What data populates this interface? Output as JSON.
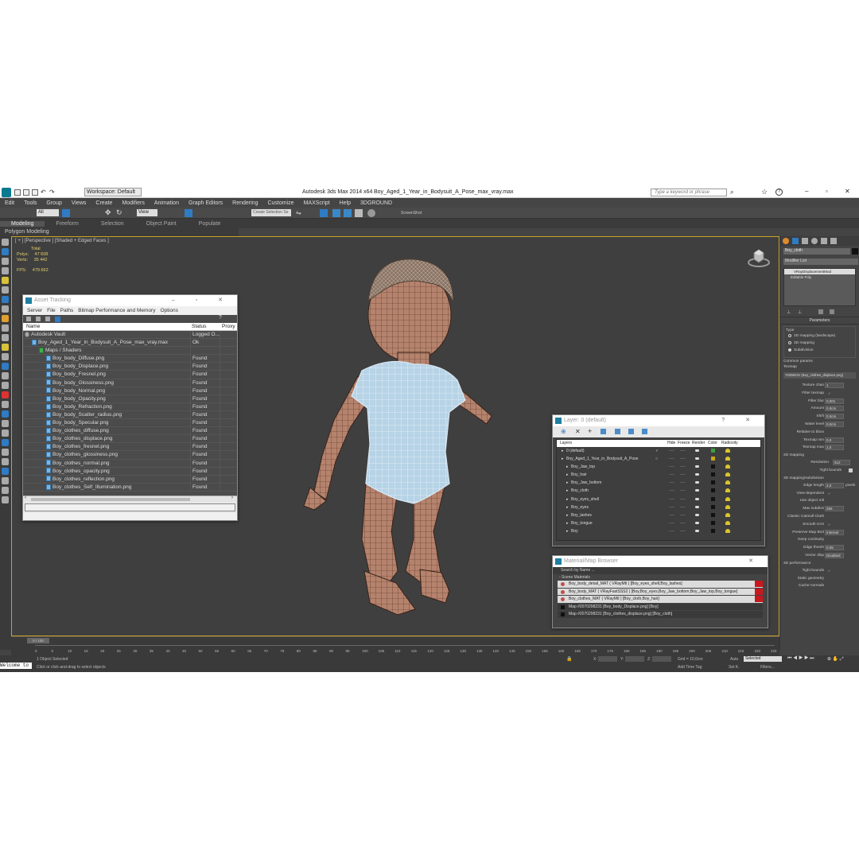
{
  "titlebar": {
    "workspace": "Workspace: Default",
    "app_title": "Autodesk 3ds Max  2014 x64",
    "file_title": "Boy_Aged_1_Year_in_Bodysuit_A_Pose_max_vray.max",
    "search_placeholder": "Type a keyword or phrase"
  },
  "menu": [
    "Edit",
    "Tools",
    "Group",
    "Views",
    "Create",
    "Modifiers",
    "Animation",
    "Graph Editors",
    "Rendering",
    "Customize",
    "MAXScript",
    "Help",
    "3DGROUND"
  ],
  "toolbar": {
    "filter": "All",
    "ref": "View",
    "selset": "Create Selection Se",
    "screenshot": "ScreenShot"
  },
  "ribbon": {
    "tabs": [
      "Modeling",
      "Freeform",
      "Selection",
      "Object Paint",
      "Populate"
    ],
    "sub": "Polygon Modeling"
  },
  "viewport": {
    "label": "[ + ] [Perspective ] [Shaded + Edged Faces ]",
    "stats": {
      "total_label": "Total",
      "polys_label": "Polys:",
      "polys": "47 608",
      "verts_label": "Verts:",
      "verts": "35 442",
      "fps_label": "FPS:",
      "fps": "479.662"
    }
  },
  "asset_tracking": {
    "title": "Asset Tracking",
    "menu": [
      "Server",
      "File",
      "Paths",
      "Bitmap Performance and Memory",
      "Options"
    ],
    "columns": [
      "Name",
      "Status",
      "Proxy"
    ],
    "rows": [
      {
        "name": "Autodesk Vault",
        "status": "Logged O...",
        "indent": 1
      },
      {
        "name": "Boy_Aged_1_Year_in_Bodysuit_A_Pose_max_vray.max",
        "status": "Ok",
        "indent": 2
      },
      {
        "name": "Maps / Shaders",
        "status": "",
        "indent": 3
      },
      {
        "name": "Boy_body_Diffuse.png",
        "status": "Found",
        "indent": 4
      },
      {
        "name": "Boy_body_Displace.png",
        "status": "Found",
        "indent": 4
      },
      {
        "name": "Boy_body_Fresnel.png",
        "status": "Found",
        "indent": 4
      },
      {
        "name": "Boy_body_Glossiness.png",
        "status": "Found",
        "indent": 4
      },
      {
        "name": "Boy_body_Normal.png",
        "status": "Found",
        "indent": 4
      },
      {
        "name": "Boy_body_Opacity.png",
        "status": "Found",
        "indent": 4
      },
      {
        "name": "Boy_body_Refraction.png",
        "status": "Found",
        "indent": 4
      },
      {
        "name": "Boy_body_Scatter_radius.png",
        "status": "Found",
        "indent": 4
      },
      {
        "name": "Boy_body_Specular.png",
        "status": "Found",
        "indent": 4
      },
      {
        "name": "Boy_clothes_diffuse.png",
        "status": "Found",
        "indent": 4
      },
      {
        "name": "Boy_clothes_displace.png",
        "status": "Found",
        "indent": 4
      },
      {
        "name": "Boy_clothes_fresnel.png",
        "status": "Found",
        "indent": 4
      },
      {
        "name": "Boy_clothes_glossiness.png",
        "status": "Found",
        "indent": 4
      },
      {
        "name": "Boy_clothes_normal.png",
        "status": "Found",
        "indent": 4
      },
      {
        "name": "Boy_clothes_opacity.png",
        "status": "Found",
        "indent": 4
      },
      {
        "name": "Boy_clothes_reflection.png",
        "status": "Found",
        "indent": 4
      },
      {
        "name": "Boy_clothes_Self_Illumination.png",
        "status": "Found",
        "indent": 4
      }
    ]
  },
  "layer_window": {
    "title": "Layer: 0 (default)",
    "columns": [
      "Layers",
      "Hide",
      "Freeze",
      "Render",
      "Color",
      "Radiosity"
    ],
    "rows": [
      {
        "name": "0 (default)",
        "level": 1,
        "check": "✓",
        "color": "#3f9e3f"
      },
      {
        "name": "Boy_Aged_1_Year_in_Bodysuit_A_Pose",
        "level": 1,
        "check": "○",
        "color": "#c8a81a"
      },
      {
        "name": "Boy_Jaw_top",
        "level": 2,
        "check": "",
        "color": "#111111"
      },
      {
        "name": "Boy_hair",
        "level": 2,
        "check": "",
        "color": "#111111"
      },
      {
        "name": "Boy_Jaw_bottom",
        "level": 2,
        "check": "",
        "color": "#111111"
      },
      {
        "name": "Boy_cloth",
        "level": 2,
        "check": "",
        "color": "#111111"
      },
      {
        "name": "Boy_eyes_shell",
        "level": 2,
        "check": "",
        "color": "#111111"
      },
      {
        "name": "Boy_eyes",
        "level": 2,
        "check": "",
        "color": "#111111"
      },
      {
        "name": "Boy_lashes",
        "level": 2,
        "check": "",
        "color": "#111111"
      },
      {
        "name": "Boy_tongue",
        "level": 2,
        "check": "",
        "color": "#111111"
      },
      {
        "name": "Boy",
        "level": 2,
        "check": "",
        "color": "#111111"
      }
    ],
    "dash": "----"
  },
  "material_browser": {
    "title": "Material/Map Browser",
    "search": "Search by Name ...",
    "group": "- Scene Materials",
    "items": [
      "Boy_body_detail_MAT ( VRayMtl ) [Boy_eyes_shell,Boy_lashes]",
      "Boy_body_MAT ( VRayFastSSS2 ) [Boy,Boy_eyes,Boy_Jaw_bottom,Boy_Jaw_top,Boy_tongue]",
      "Boy_clothes_MAT ( VRayMtl ) [Boy_cloth,Boy_hair]",
      "Map #2070298231 [Boy_body_Displace.png] [Boy]",
      "Map #2070298231 [Boy_clothes_displace.png] [Boy_cloth]"
    ]
  },
  "command_panel": {
    "object_name": "Boy_cloth",
    "modifier_list": "Modifier List",
    "stack": [
      "VRayDisplacementMod",
      "Editable Poly"
    ],
    "parameters": "Parameters",
    "type_label": "Type",
    "types": [
      "2D mapping (landscape)",
      "3D mapping",
      "Subdivision"
    ],
    "common_params": "Common params",
    "texmap_label": "Texmap",
    "texmap": "70298231 (Boy_clothes_displace.png)",
    "props": [
      {
        "label": "Texture chan",
        "value": "1"
      },
      {
        "label": "Filter texmap",
        "value": "✓"
      },
      {
        "label": "Filter blur",
        "value": "0,001"
      },
      {
        "label": "Amount",
        "value": "0,0cm"
      },
      {
        "label": "Shift",
        "value": "0,0cm"
      },
      {
        "label": "Water level",
        "value": "0,0cm"
      },
      {
        "label": "Relative to bbox",
        "value": ""
      },
      {
        "label": "Texmap min",
        "value": "0,0"
      },
      {
        "label": "Texmap max",
        "value": "1,0"
      }
    ],
    "mapping_2d": "2D mapping",
    "resolution_label": "Resolution",
    "resolution": "512",
    "tight_bounds": "Tight bounds",
    "subdiv_header": "3D mapping/subdivision",
    "subdiv": [
      {
        "label": "Edge length",
        "value": "2,0",
        "unit": "pixels"
      },
      {
        "label": "View-dependent",
        "value": "✓"
      },
      {
        "label": "Use object mtl",
        "value": ""
      },
      {
        "label": "Max subdivs",
        "value": "256"
      },
      {
        "label": "Classic Catmull-Clark",
        "value": ""
      },
      {
        "label": "Smooth UVs",
        "value": "✓"
      },
      {
        "label": "Preserve Map Bnd",
        "value": "Internal"
      },
      {
        "label": "Keep continuity",
        "value": ""
      },
      {
        "label": "Edge thresh",
        "value": "0,05"
      },
      {
        "label": "Vector disp",
        "value": "Disabled"
      }
    ],
    "perf_header": "3D performance",
    "perf": [
      {
        "label": "Tight bounds",
        "value": "✓"
      },
      {
        "label": "Static geometry",
        "value": ""
      },
      {
        "label": "Cache normals",
        "value": ""
      }
    ]
  },
  "timeline": {
    "frame": "0 / 100",
    "ticks": [
      "0",
      "5",
      "10",
      "15",
      "20",
      "25",
      "30",
      "35",
      "40",
      "45",
      "50",
      "55",
      "60",
      "65",
      "70",
      "75",
      "80",
      "85",
      "90",
      "95",
      "100",
      "105",
      "110",
      "115",
      "120",
      "125",
      "130",
      "135",
      "140",
      "145",
      "150",
      "155",
      "160",
      "165",
      "170",
      "175",
      "180",
      "185",
      "190",
      "195",
      "200",
      "205",
      "210",
      "215",
      "220",
      "225"
    ]
  },
  "status": {
    "welcome": "Welcome to",
    "selected": "1 Object Selected",
    "hint": "Click or click-and-drag to select objects",
    "x_label": "X:",
    "y_label": "Y:",
    "z_label": "Z:",
    "grid": "Grid = 10,0cm",
    "add_time_tag": "Add Time Tag",
    "auto": "Auto",
    "selected_dd": "Selected",
    "set_k": "Set K.",
    "filters": "Filters..."
  }
}
